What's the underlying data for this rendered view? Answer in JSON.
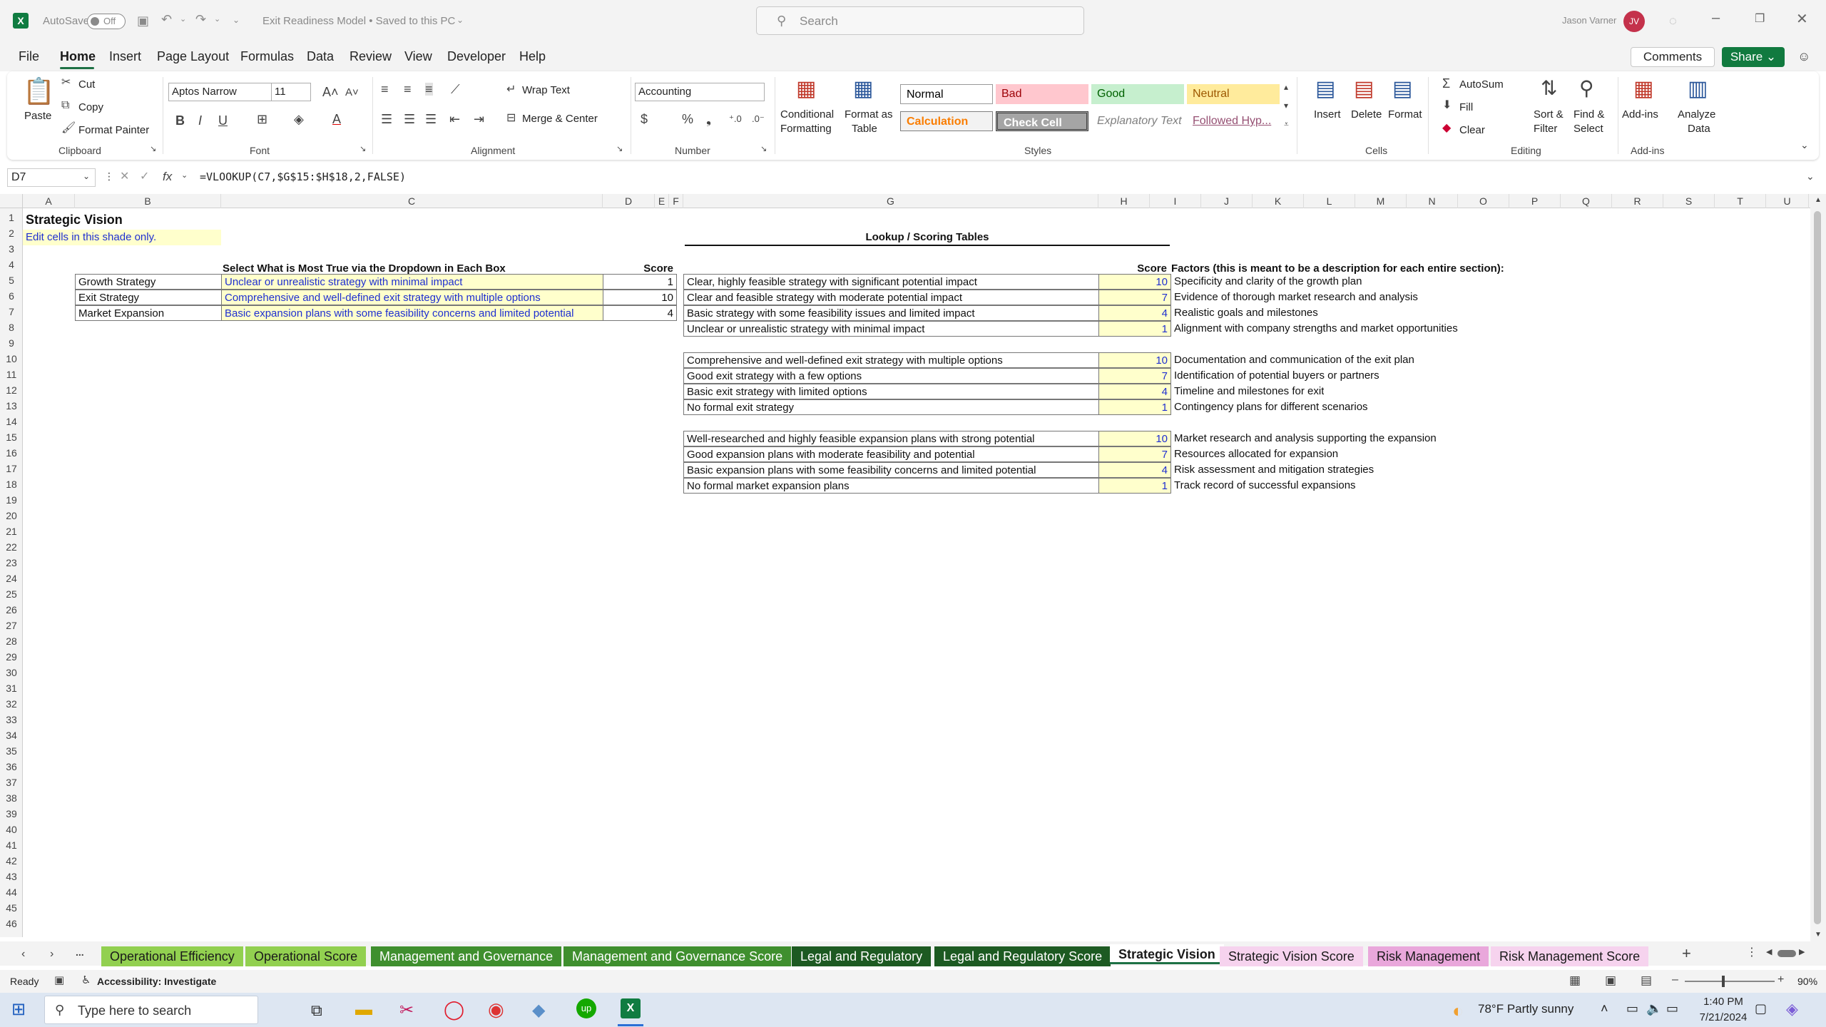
{
  "titlebar": {
    "autosave": "AutoSave",
    "toggle": "Off",
    "doc_title": "Exit Readiness Model • Saved to this PC",
    "search_placeholder": "Search",
    "user_name": "Jason Varner",
    "initials": "JV"
  },
  "menu": [
    "File",
    "Home",
    "Insert",
    "Page Layout",
    "Formulas",
    "Data",
    "Review",
    "View",
    "Developer",
    "Help"
  ],
  "menu_right": {
    "comments": "Comments",
    "share": "Share"
  },
  "ribbon": {
    "clipboard": {
      "paste": "Paste",
      "cut": "Cut",
      "copy": "Copy",
      "format_painter": "Format Painter",
      "label": "Clipboard"
    },
    "font": {
      "name": "Aptos Narrow",
      "size": "11",
      "label": "Font"
    },
    "alignment": {
      "wrap": "Wrap Text",
      "merge": "Merge & Center",
      "label": "Alignment"
    },
    "number": {
      "format": "Accounting",
      "label": "Number"
    },
    "styles": {
      "conditional": "Conditional",
      "conditional2": "Formatting",
      "format_table": "Format as",
      "format_table2": "Table",
      "normal": "Normal",
      "bad": "Bad",
      "good": "Good",
      "neutral": "Neutral",
      "calculation": "Calculation",
      "check_cell": "Check Cell",
      "explanatory": "Explanatory Text",
      "followed": "Followed Hyp...",
      "label": "Styles"
    },
    "cells": {
      "insert": "Insert",
      "delete": "Delete",
      "format": "Format",
      "label": "Cells"
    },
    "editing": {
      "autosum": "AutoSum",
      "fill": "Fill",
      "clear": "Clear",
      "sort": "Sort &",
      "sort2": "Filter",
      "find": "Find &",
      "find2": "Select",
      "label": "Editing"
    },
    "addins": {
      "addins": "Add-ins",
      "analyze": "Analyze",
      "analyze2": "Data",
      "label": "Add-ins"
    }
  },
  "formula_bar": {
    "name_box": "D7",
    "fx": "fx",
    "formula": "=VLOOKUP(C7,$G$15:$H$18,2,FALSE)"
  },
  "columns": [
    "A",
    "B",
    "C",
    "D",
    "E",
    "F",
    "G",
    "H",
    "I",
    "J",
    "K",
    "L",
    "M",
    "N",
    "O",
    "P",
    "Q",
    "R",
    "S",
    "T",
    "U"
  ],
  "rows": [
    "1",
    "2",
    "3",
    "4",
    "5",
    "6",
    "7",
    "8",
    "9",
    "10",
    "11",
    "12",
    "13",
    "14",
    "15",
    "16",
    "17",
    "18",
    "19",
    "20",
    "21",
    "22",
    "23",
    "24",
    "25",
    "26",
    "27",
    "28",
    "29",
    "30",
    "31",
    "32",
    "33",
    "34",
    "35",
    "36",
    "37",
    "38",
    "39",
    "40",
    "41",
    "42",
    "43",
    "44",
    "45",
    "46"
  ],
  "sheet": {
    "title": "Strategic Vision",
    "edit_note": "Edit cells in this shade only.",
    "select_header": "Select What is Most True via the Dropdown in Each Box",
    "score_header": "Score",
    "selections": [
      {
        "label": "Growth Strategy",
        "choice": "Unclear or unrealistic strategy with minimal impact",
        "score": "1"
      },
      {
        "label": "Exit Strategy",
        "choice": "Comprehensive and well-defined exit strategy with multiple options",
        "score": "10"
      },
      {
        "label": "Market Expansion",
        "choice": "Basic expansion plans with some feasibility concerns and limited potential",
        "score": "4"
      }
    ],
    "lookup_title": "Lookup  / Scoring Tables",
    "lookup_score_header": "Score",
    "factors_header": "Factors (this is meant to be a description for each entire section):",
    "tables": [
      [
        {
          "text": "Clear, highly feasible strategy with significant potential impact",
          "score": "10",
          "factor": "Specificity and clarity of the growth plan"
        },
        {
          "text": "Clear and feasible strategy with moderate potential impact",
          "score": "7",
          "factor": "Evidence of thorough market research and analysis"
        },
        {
          "text": "Basic strategy with some feasibility issues and limited impact",
          "score": "4",
          "factor": "Realistic goals and milestones"
        },
        {
          "text": "Unclear or unrealistic strategy with minimal impact",
          "score": "1",
          "factor": "Alignment with company strengths and market opportunities"
        }
      ],
      [
        {
          "text": "Comprehensive and well-defined exit strategy with multiple options",
          "score": "10",
          "factor": "Documentation and communication of the exit plan"
        },
        {
          "text": "Good exit strategy with a few options",
          "score": "7",
          "factor": "Identification of potential buyers or partners"
        },
        {
          "text": "Basic exit strategy with limited options",
          "score": "4",
          "factor": "Timeline and milestones for exit"
        },
        {
          "text": "No formal exit strategy",
          "score": "1",
          "factor": "Contingency plans for different scenarios"
        }
      ],
      [
        {
          "text": "Well-researched and highly feasible expansion plans with strong potential",
          "score": "10",
          "factor": "Market research and analysis supporting the expansion"
        },
        {
          "text": "Good expansion plans with moderate feasibility and potential",
          "score": "7",
          "factor": "Resources allocated for expansion"
        },
        {
          "text": "Basic expansion plans with some feasibility concerns and limited potential",
          "score": "4",
          "factor": "Risk assessment and mitigation strategies"
        },
        {
          "text": "No formal market expansion plans",
          "score": "1",
          "factor": "Track record of successful expansions"
        }
      ]
    ]
  },
  "tabs": [
    {
      "name": "Operational Efficiency",
      "bg": "#92d050",
      "fg": "#1a1a1a"
    },
    {
      "name": "Operational Score",
      "bg": "#92d050",
      "fg": "#1a1a1a"
    },
    {
      "name": "Management and Governance",
      "bg": "#3f8f2e",
      "fg": "#ffffff"
    },
    {
      "name": "Management and Governance Score",
      "bg": "#3f8f2e",
      "fg": "#ffffff"
    },
    {
      "name": "Legal and Regulatory",
      "bg": "#1d5a22",
      "fg": "#ffffff"
    },
    {
      "name": "Legal and Regulatory Score",
      "bg": "#1d5a22",
      "fg": "#ffffff"
    },
    {
      "name": "Strategic Vision",
      "bg": "#ffffff",
      "fg": "#1a1a1a"
    },
    {
      "name": "Strategic Vision Score",
      "bg": "#f6d3ee",
      "fg": "#1a1a1a"
    },
    {
      "name": "Risk Management",
      "bg": "#e9a7db",
      "fg": "#1a1a1a"
    },
    {
      "name": "Risk Management Score",
      "bg": "#f6d3ee",
      "fg": "#1a1a1a"
    }
  ],
  "tabs_more": "...",
  "status": {
    "ready": "Ready",
    "accessibility": "Accessibility: Investigate",
    "zoom": "90%"
  },
  "taskbar": {
    "search_placeholder": "Type here to search",
    "weather": "78°F  Partly sunny",
    "time": "1:40 PM",
    "date": "7/21/2024"
  }
}
